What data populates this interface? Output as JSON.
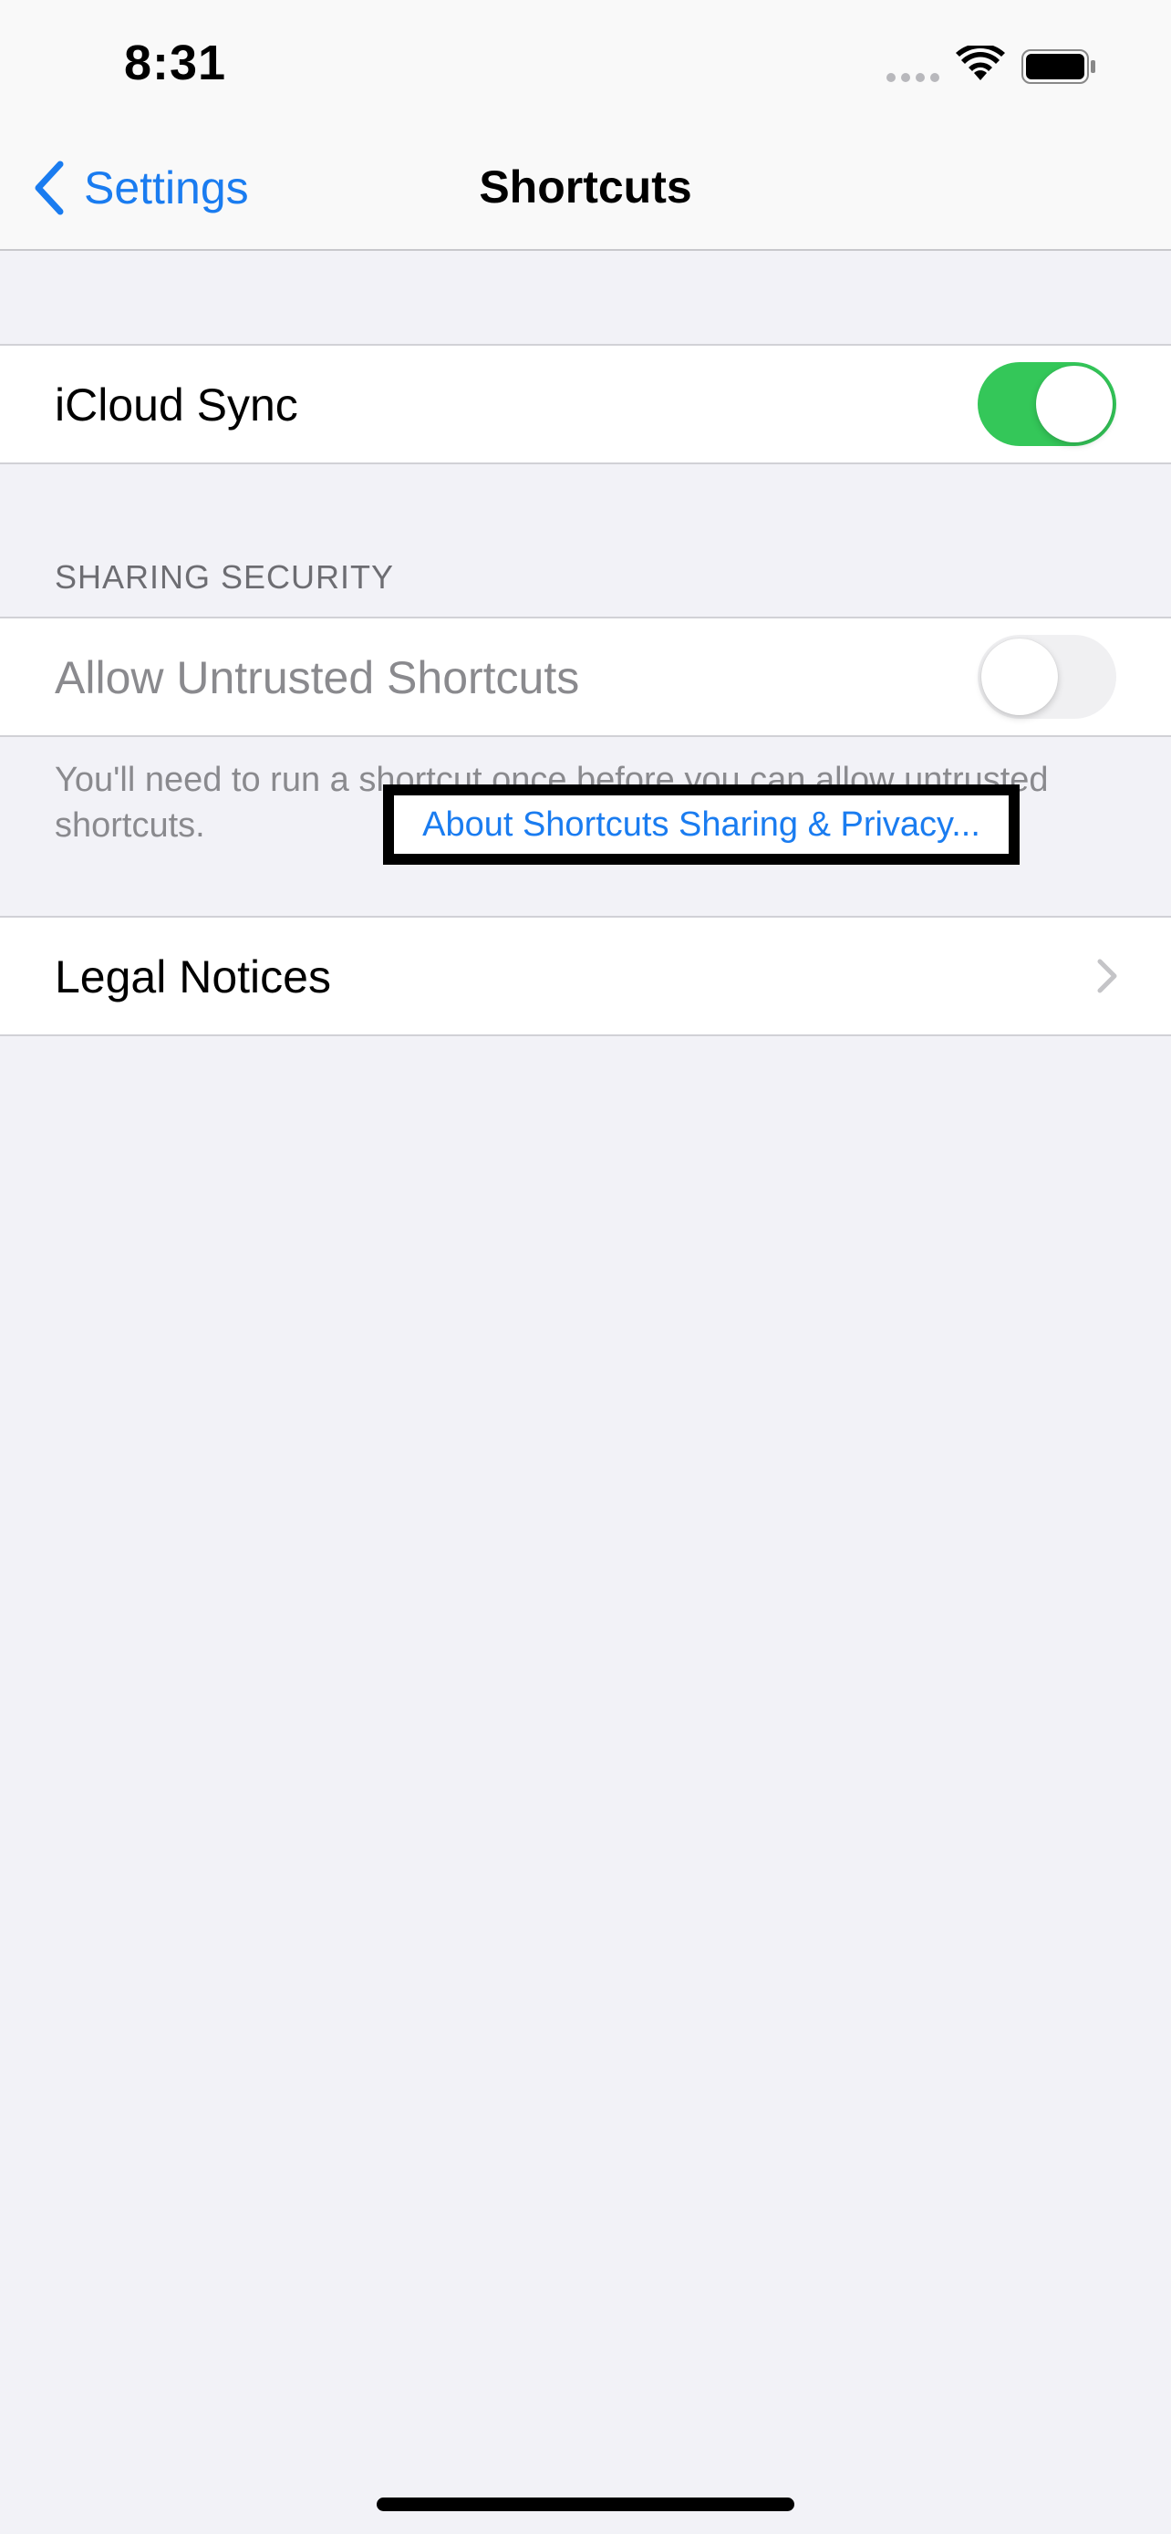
{
  "status_bar": {
    "time": "8:31"
  },
  "nav": {
    "back_label": "Settings",
    "title": "Shortcuts"
  },
  "icloud_sync": {
    "label": "iCloud Sync",
    "enabled": true
  },
  "sharing_security": {
    "header": "SHARING SECURITY",
    "allow_untrusted_label": "Allow Untrusted Shortcuts",
    "allow_untrusted_enabled": false,
    "footer_text": "You'll need to run a shortcut once before you can allow untrusted shortcuts.",
    "footer_link": "About Shortcuts Sharing & Privacy..."
  },
  "legal": {
    "label": "Legal Notices"
  },
  "colors": {
    "accent": "#1a7cf0",
    "toggle_on": "#34c759",
    "background": "#f2f2f7"
  }
}
